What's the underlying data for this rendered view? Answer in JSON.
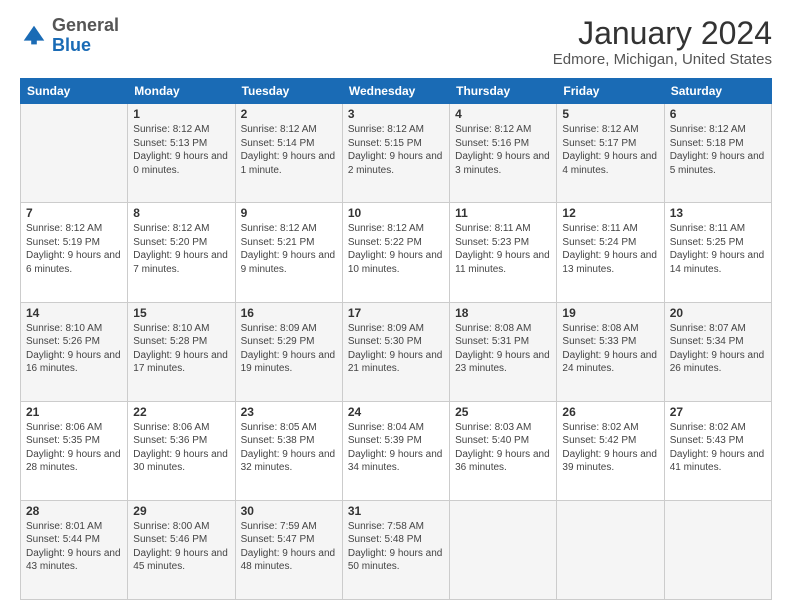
{
  "header": {
    "logo_general": "General",
    "logo_blue": "Blue",
    "title": "January 2024",
    "subtitle": "Edmore, Michigan, United States"
  },
  "days_of_week": [
    "Sunday",
    "Monday",
    "Tuesday",
    "Wednesday",
    "Thursday",
    "Friday",
    "Saturday"
  ],
  "weeks": [
    [
      {
        "day": "",
        "sunrise": "",
        "sunset": "",
        "daylight": ""
      },
      {
        "day": "1",
        "sunrise": "Sunrise: 8:12 AM",
        "sunset": "Sunset: 5:13 PM",
        "daylight": "Daylight: 9 hours and 0 minutes."
      },
      {
        "day": "2",
        "sunrise": "Sunrise: 8:12 AM",
        "sunset": "Sunset: 5:14 PM",
        "daylight": "Daylight: 9 hours and 1 minute."
      },
      {
        "day": "3",
        "sunrise": "Sunrise: 8:12 AM",
        "sunset": "Sunset: 5:15 PM",
        "daylight": "Daylight: 9 hours and 2 minutes."
      },
      {
        "day": "4",
        "sunrise": "Sunrise: 8:12 AM",
        "sunset": "Sunset: 5:16 PM",
        "daylight": "Daylight: 9 hours and 3 minutes."
      },
      {
        "day": "5",
        "sunrise": "Sunrise: 8:12 AM",
        "sunset": "Sunset: 5:17 PM",
        "daylight": "Daylight: 9 hours and 4 minutes."
      },
      {
        "day": "6",
        "sunrise": "Sunrise: 8:12 AM",
        "sunset": "Sunset: 5:18 PM",
        "daylight": "Daylight: 9 hours and 5 minutes."
      }
    ],
    [
      {
        "day": "7",
        "sunrise": "Sunrise: 8:12 AM",
        "sunset": "Sunset: 5:19 PM",
        "daylight": "Daylight: 9 hours and 6 minutes."
      },
      {
        "day": "8",
        "sunrise": "Sunrise: 8:12 AM",
        "sunset": "Sunset: 5:20 PM",
        "daylight": "Daylight: 9 hours and 7 minutes."
      },
      {
        "day": "9",
        "sunrise": "Sunrise: 8:12 AM",
        "sunset": "Sunset: 5:21 PM",
        "daylight": "Daylight: 9 hours and 9 minutes."
      },
      {
        "day": "10",
        "sunrise": "Sunrise: 8:12 AM",
        "sunset": "Sunset: 5:22 PM",
        "daylight": "Daylight: 9 hours and 10 minutes."
      },
      {
        "day": "11",
        "sunrise": "Sunrise: 8:11 AM",
        "sunset": "Sunset: 5:23 PM",
        "daylight": "Daylight: 9 hours and 11 minutes."
      },
      {
        "day": "12",
        "sunrise": "Sunrise: 8:11 AM",
        "sunset": "Sunset: 5:24 PM",
        "daylight": "Daylight: 9 hours and 13 minutes."
      },
      {
        "day": "13",
        "sunrise": "Sunrise: 8:11 AM",
        "sunset": "Sunset: 5:25 PM",
        "daylight": "Daylight: 9 hours and 14 minutes."
      }
    ],
    [
      {
        "day": "14",
        "sunrise": "Sunrise: 8:10 AM",
        "sunset": "Sunset: 5:26 PM",
        "daylight": "Daylight: 9 hours and 16 minutes."
      },
      {
        "day": "15",
        "sunrise": "Sunrise: 8:10 AM",
        "sunset": "Sunset: 5:28 PM",
        "daylight": "Daylight: 9 hours and 17 minutes."
      },
      {
        "day": "16",
        "sunrise": "Sunrise: 8:09 AM",
        "sunset": "Sunset: 5:29 PM",
        "daylight": "Daylight: 9 hours and 19 minutes."
      },
      {
        "day": "17",
        "sunrise": "Sunrise: 8:09 AM",
        "sunset": "Sunset: 5:30 PM",
        "daylight": "Daylight: 9 hours and 21 minutes."
      },
      {
        "day": "18",
        "sunrise": "Sunrise: 8:08 AM",
        "sunset": "Sunset: 5:31 PM",
        "daylight": "Daylight: 9 hours and 23 minutes."
      },
      {
        "day": "19",
        "sunrise": "Sunrise: 8:08 AM",
        "sunset": "Sunset: 5:33 PM",
        "daylight": "Daylight: 9 hours and 24 minutes."
      },
      {
        "day": "20",
        "sunrise": "Sunrise: 8:07 AM",
        "sunset": "Sunset: 5:34 PM",
        "daylight": "Daylight: 9 hours and 26 minutes."
      }
    ],
    [
      {
        "day": "21",
        "sunrise": "Sunrise: 8:06 AM",
        "sunset": "Sunset: 5:35 PM",
        "daylight": "Daylight: 9 hours and 28 minutes."
      },
      {
        "day": "22",
        "sunrise": "Sunrise: 8:06 AM",
        "sunset": "Sunset: 5:36 PM",
        "daylight": "Daylight: 9 hours and 30 minutes."
      },
      {
        "day": "23",
        "sunrise": "Sunrise: 8:05 AM",
        "sunset": "Sunset: 5:38 PM",
        "daylight": "Daylight: 9 hours and 32 minutes."
      },
      {
        "day": "24",
        "sunrise": "Sunrise: 8:04 AM",
        "sunset": "Sunset: 5:39 PM",
        "daylight": "Daylight: 9 hours and 34 minutes."
      },
      {
        "day": "25",
        "sunrise": "Sunrise: 8:03 AM",
        "sunset": "Sunset: 5:40 PM",
        "daylight": "Daylight: 9 hours and 36 minutes."
      },
      {
        "day": "26",
        "sunrise": "Sunrise: 8:02 AM",
        "sunset": "Sunset: 5:42 PM",
        "daylight": "Daylight: 9 hours and 39 minutes."
      },
      {
        "day": "27",
        "sunrise": "Sunrise: 8:02 AM",
        "sunset": "Sunset: 5:43 PM",
        "daylight": "Daylight: 9 hours and 41 minutes."
      }
    ],
    [
      {
        "day": "28",
        "sunrise": "Sunrise: 8:01 AM",
        "sunset": "Sunset: 5:44 PM",
        "daylight": "Daylight: 9 hours and 43 minutes."
      },
      {
        "day": "29",
        "sunrise": "Sunrise: 8:00 AM",
        "sunset": "Sunset: 5:46 PM",
        "daylight": "Daylight: 9 hours and 45 minutes."
      },
      {
        "day": "30",
        "sunrise": "Sunrise: 7:59 AM",
        "sunset": "Sunset: 5:47 PM",
        "daylight": "Daylight: 9 hours and 48 minutes."
      },
      {
        "day": "31",
        "sunrise": "Sunrise: 7:58 AM",
        "sunset": "Sunset: 5:48 PM",
        "daylight": "Daylight: 9 hours and 50 minutes."
      },
      {
        "day": "",
        "sunrise": "",
        "sunset": "",
        "daylight": ""
      },
      {
        "day": "",
        "sunrise": "",
        "sunset": "",
        "daylight": ""
      },
      {
        "day": "",
        "sunrise": "",
        "sunset": "",
        "daylight": ""
      }
    ]
  ]
}
